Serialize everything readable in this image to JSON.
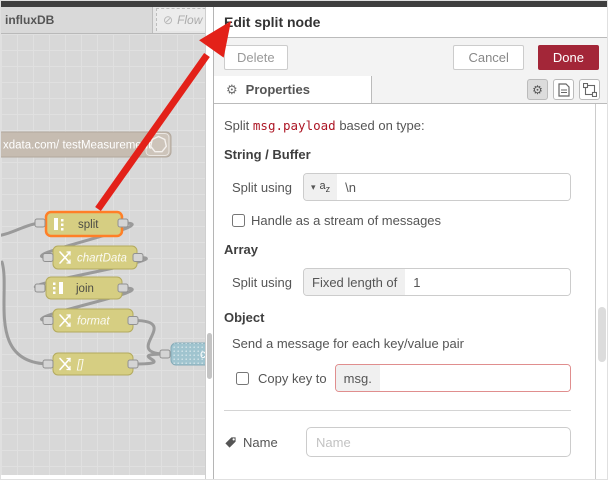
{
  "canvas": {
    "tabs": {
      "active_label": "influxDB",
      "disabled_label": "Flow"
    },
    "node_labels": {
      "influx": "xdata.com/ testMeasurement",
      "split": "split",
      "chart_data": "chartData",
      "join": "join",
      "format": "format",
      "brackets": "[]",
      "chart_clipped": "c"
    }
  },
  "panel": {
    "title": "Edit split node",
    "delete_label": "Delete",
    "cancel_label": "Cancel",
    "done_label": "Done",
    "properties_tab": "Properties",
    "form": {
      "intro_prefix": "Split ",
      "intro_property": "msg.payload",
      "intro_suffix": " based on type:",
      "string_heading": "String / Buffer",
      "split_using_label": "Split using",
      "type_a": "a",
      "type_z": "z",
      "string_value": "\\n",
      "stream_label": "Handle as a stream of messages",
      "array_heading": "Array",
      "array_split_label": "Split using",
      "array_prefix": "Fixed length of",
      "array_value": "1",
      "object_heading": "Object",
      "object_text": "Send a message for each key/value pair",
      "copy_key_label": "Copy key to",
      "copy_key_prefix": "msg.",
      "copy_key_value": "",
      "name_label": "Name",
      "name_placeholder": "Name",
      "name_value": ""
    }
  },
  "glyphs": {
    "caret_down": "▾",
    "gear": "⚙",
    "no_entry": "⊘"
  },
  "colors": {
    "done_button": "#a32638",
    "code_red": "#ad1625",
    "node_khaki": "#d6ce82",
    "node_selected_border": "#ff7f27",
    "node_influx": "#c6bcb1",
    "node_chart_blue": "#a0c4cf",
    "wire_grey": "#9a9a9a",
    "annotation_arrow": "#e32119",
    "canvas_bg": "#d8d8d8"
  }
}
